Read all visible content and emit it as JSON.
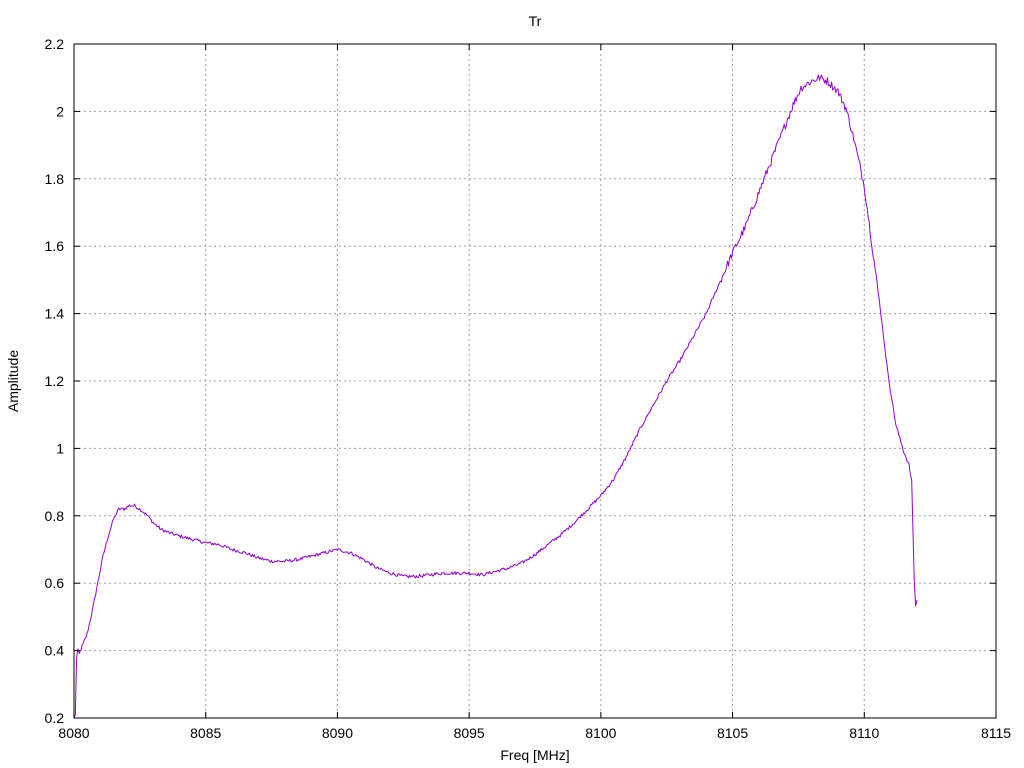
{
  "chart_data": {
    "type": "line",
    "title": "Tr",
    "xlabel": "Freq [MHz]",
    "ylabel": "Amplitude",
    "xlim": [
      8080,
      8115
    ],
    "ylim": [
      0.2,
      2.2
    ],
    "xticks": [
      8080,
      8085,
      8090,
      8095,
      8100,
      8105,
      8110,
      8115
    ],
    "yticks": [
      0.2,
      0.4,
      0.6,
      0.8,
      1,
      1.2,
      1.4,
      1.6,
      1.8,
      2,
      2.2
    ],
    "xtick_labels": [
      "8080",
      "8085",
      "8090",
      "8095",
      "8100",
      "8105",
      "8110",
      "8115"
    ],
    "ytick_labels": [
      "0.2",
      "0.4",
      "0.6",
      "0.8",
      "1",
      "1.2",
      "1.4",
      "1.6",
      "1.8",
      "2",
      "2.2"
    ],
    "grid": true,
    "series": [
      {
        "color": "#9400d3",
        "x": [
          8080.0,
          8080.05,
          8080.1,
          8080.15,
          8080.2,
          8080.3,
          8080.5,
          8080.7,
          8080.9,
          8081.1,
          8081.3,
          8081.5,
          8081.7,
          8081.9,
          8082.1,
          8082.3,
          8082.5,
          8082.8,
          8083.0,
          8083.3,
          8083.6,
          8084.0,
          8084.5,
          8085.0,
          8085.5,
          8086.0,
          8086.5,
          8087.0,
          8087.5,
          8088.0,
          8088.5,
          8089.0,
          8089.5,
          8090.0,
          8090.5,
          8091.0,
          8091.5,
          8092.0,
          8092.5,
          8093.0,
          8093.5,
          8094.0,
          8094.5,
          8095.0,
          8095.5,
          8096.0,
          8096.5,
          8097.0,
          8097.5,
          8098.0,
          8098.5,
          8099.0,
          8099.5,
          8100.0,
          8100.5,
          8101.0,
          8101.5,
          8102.0,
          8102.5,
          8103.0,
          8103.5,
          8104.0,
          8104.5,
          8105.0,
          8105.5,
          8106.0,
          8106.5,
          8107.0,
          8107.3,
          8107.6,
          8108.0,
          8108.3,
          8108.6,
          8109.0,
          8109.3,
          8109.6,
          8110.0,
          8110.3,
          8110.6,
          8110.9,
          8111.2,
          8111.5,
          8111.7,
          8111.8,
          8111.85,
          8111.9,
          8111.95,
          8112.0
        ],
        "values": [
          0.2,
          0.21,
          0.38,
          0.4,
          0.39,
          0.41,
          0.45,
          0.52,
          0.6,
          0.68,
          0.74,
          0.79,
          0.82,
          0.82,
          0.83,
          0.83,
          0.82,
          0.8,
          0.78,
          0.76,
          0.75,
          0.74,
          0.73,
          0.72,
          0.715,
          0.7,
          0.69,
          0.675,
          0.665,
          0.665,
          0.67,
          0.68,
          0.69,
          0.7,
          0.69,
          0.67,
          0.645,
          0.63,
          0.62,
          0.62,
          0.625,
          0.63,
          0.63,
          0.63,
          0.625,
          0.635,
          0.645,
          0.66,
          0.685,
          0.715,
          0.745,
          0.78,
          0.82,
          0.86,
          0.91,
          0.98,
          1.06,
          1.13,
          1.2,
          1.26,
          1.33,
          1.4,
          1.49,
          1.58,
          1.66,
          1.76,
          1.86,
          1.96,
          2.02,
          2.07,
          2.09,
          2.1,
          2.09,
          2.06,
          2.01,
          1.92,
          1.78,
          1.6,
          1.42,
          1.22,
          1.07,
          0.99,
          0.95,
          0.9,
          0.75,
          0.6,
          0.53,
          0.55
        ]
      }
    ]
  }
}
